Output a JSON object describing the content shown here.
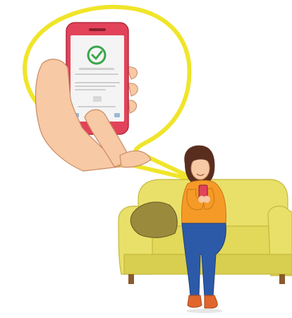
{
  "scene": {
    "description_free": true,
    "colors": {
      "bubble_fill": "#ffffff",
      "bubble_stroke": "#f0e52a",
      "phone_body": "#e2435a",
      "phone_screen": "#f4f4f4",
      "check_green": "#3aa64a",
      "skin": "#f7c9a4",
      "skin_shadow": "#e9aa84",
      "sofa": "#e9e069",
      "sofa_shadow": "#d3c84a",
      "sofa_legs": "#8a5a2b",
      "cushion": "#9a8a3c",
      "shirt": "#f59a27",
      "jeans": "#2d5aa8",
      "hair": "#5a2e1f",
      "shoes": "#e0662b"
    },
    "icons": {
      "success": "check-circle-icon"
    }
  }
}
